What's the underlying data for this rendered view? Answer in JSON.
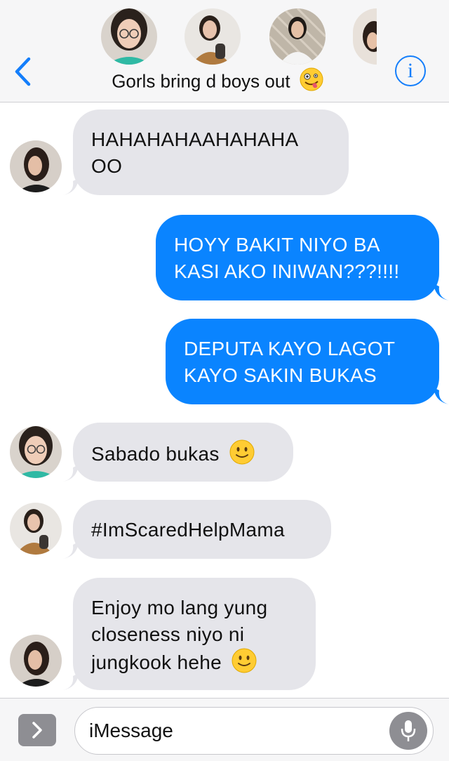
{
  "header": {
    "group_name": "Gorls bring d boys out",
    "title_emoji": "zany-face-emoji",
    "back_icon": "chevron-left-icon",
    "info_icon": "info-icon",
    "accent_color": "#147efb",
    "info_label": "i"
  },
  "messages": [
    {
      "direction": "received",
      "text": "HAHAHAHAAHAHAHA OO",
      "avatar": "avatar-friend-1"
    },
    {
      "direction": "sent",
      "text": "HOYY BAKIT NIYO BA KASI AKO INIWAN???!!!!"
    },
    {
      "direction": "sent",
      "text": "DEPUTA KAYO LAGOT KAYO SAKIN BUKAS"
    },
    {
      "direction": "received",
      "text": "Sabado bukas",
      "emoji": "slightly-smiling-face-emoji",
      "avatar": "avatar-friend-2"
    },
    {
      "direction": "received",
      "text": "#ImScaredHelpMama",
      "avatar": "avatar-friend-3"
    },
    {
      "direction": "received",
      "text": "Enjoy mo lang yung closeness niyo ni jungkook hehe",
      "emoji": "slightly-smiling-face-emoji",
      "avatar": "avatar-friend-1"
    }
  ],
  "colors": {
    "sent_bubble": "#0a84ff",
    "received_bubble": "#e5e5ea"
  },
  "input_bar": {
    "placeholder": "iMessage",
    "apps_icon": "chevron-right-icon",
    "mic_icon": "microphone-icon"
  }
}
